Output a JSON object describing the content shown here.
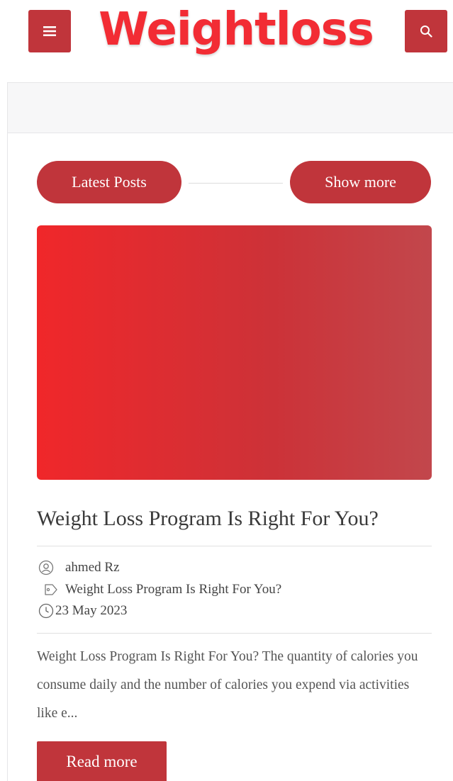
{
  "header": {
    "logo_text": "Weightloss",
    "menu_icon": "hamburger-icon",
    "search_icon": "search-icon",
    "accent_color": "#c0353b",
    "logo_color": "#f22c34"
  },
  "section": {
    "latest_label": "Latest Posts",
    "show_more_label": "Show more"
  },
  "post": {
    "title": "Weight Loss Program Is Right For You?",
    "author": "ahmed Rz",
    "tag": "Weight Loss Program Is Right For You?",
    "date": "23 May 2023",
    "excerpt": "Weight Loss Program Is Right For You? The quantity of calories you consume daily and the number of calories you expend via activities like e...",
    "read_more_label": "Read more",
    "author_icon": "user-icon",
    "tag_icon": "tag-icon",
    "date_icon": "clock-icon"
  }
}
